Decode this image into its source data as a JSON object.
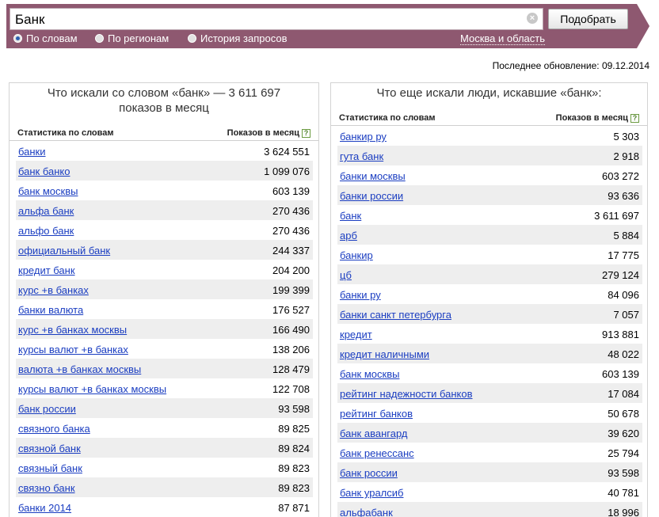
{
  "search": {
    "value": "Банк",
    "button_label": "Подобрать"
  },
  "modes": [
    {
      "label": "По словам",
      "checked": true
    },
    {
      "label": "По регионам",
      "checked": false
    },
    {
      "label": "История запросов",
      "checked": false
    }
  ],
  "region": "Москва и область",
  "last_update": "Последнее обновление: 09.12.2014",
  "left": {
    "title_line1": "Что искали со словом «банк» — 3 611 697",
    "title_line2": "показов в месяц",
    "col_phrase": "Статистика по словам",
    "col_count": "Показов в месяц",
    "rows": [
      {
        "phrase": "банки",
        "count": "3 624 551"
      },
      {
        "phrase": "банк банко",
        "count": "1 099 076"
      },
      {
        "phrase": "банк москвы",
        "count": "603 139"
      },
      {
        "phrase": "альфа банк",
        "count": "270 436"
      },
      {
        "phrase": "альфо банк",
        "count": "270 436"
      },
      {
        "phrase": "официальный банк",
        "count": "244 337"
      },
      {
        "phrase": "кредит банк",
        "count": "204 200"
      },
      {
        "phrase": "курс +в банках",
        "count": "199 399"
      },
      {
        "phrase": "банки валюта",
        "count": "176 527"
      },
      {
        "phrase": "курс +в банках москвы",
        "count": "166 490"
      },
      {
        "phrase": "курсы валют +в банках",
        "count": "138 206"
      },
      {
        "phrase": "валюта +в банках москвы",
        "count": "128 479"
      },
      {
        "phrase": "курсы валют +в банках москвы",
        "count": "122 708"
      },
      {
        "phrase": "банк россии",
        "count": "93 598"
      },
      {
        "phrase": "связного банка",
        "count": "89 825"
      },
      {
        "phrase": "связной банк",
        "count": "89 824"
      },
      {
        "phrase": "связный банк",
        "count": "89 823"
      },
      {
        "phrase": "связно банк",
        "count": "89 823"
      },
      {
        "phrase": "банки 2014",
        "count": "87 871"
      }
    ]
  },
  "right": {
    "title": "Что еще искали люди, искавшие «банк»:",
    "col_phrase": "Статистика по словам",
    "col_count": "Показов в месяц",
    "rows": [
      {
        "phrase": "банкир ру",
        "count": "5 303"
      },
      {
        "phrase": "гута банк",
        "count": "2 918"
      },
      {
        "phrase": "банки москвы",
        "count": "603 272"
      },
      {
        "phrase": "банки россии",
        "count": "93 636"
      },
      {
        "phrase": "банк",
        "count": "3 611 697"
      },
      {
        "phrase": "арб",
        "count": "5 884"
      },
      {
        "phrase": "банкир",
        "count": "17 775"
      },
      {
        "phrase": "цб",
        "count": "279 124"
      },
      {
        "phrase": "банки ру",
        "count": "84 096"
      },
      {
        "phrase": "банки санкт петербурга",
        "count": "7 057"
      },
      {
        "phrase": "кредит",
        "count": "913 881"
      },
      {
        "phrase": "кредит наличными",
        "count": "48 022"
      },
      {
        "phrase": "банк москвы",
        "count": "603 139"
      },
      {
        "phrase": "рейтинг надежности банков",
        "count": "17 084"
      },
      {
        "phrase": "рейтинг банков",
        "count": "50 678"
      },
      {
        "phrase": "банк авангард",
        "count": "39 620"
      },
      {
        "phrase": "банк ренессанс",
        "count": "25 794"
      },
      {
        "phrase": "банк россии",
        "count": "93 598"
      },
      {
        "phrase": "банк уралсиб",
        "count": "40 781"
      },
      {
        "phrase": "альфабанк",
        "count": "18 996"
      }
    ]
  }
}
